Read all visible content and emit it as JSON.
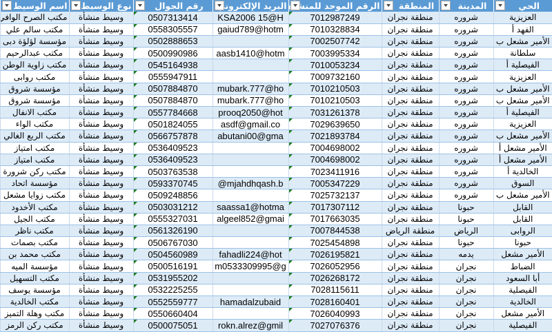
{
  "headers": [
    "الحي",
    "المدينة",
    "المنطقة",
    "الرقم الموحد للمنشأة",
    "البريد الإلكتروني",
    "رقم الجوال",
    "نوع الوسيط",
    "اسم الوسيط"
  ],
  "colors": {
    "header_bg": "#5b9bd5",
    "band": "#ddebf7",
    "error_marker": "#1e7b1e"
  },
  "rows": [
    [
      "العزيزية",
      "شروره",
      "منطقة نجران",
      "7012987249",
      "KSA2006  15@H",
      "0507313414",
      "وسيط منشأة",
      "مكتب الصرح الوافي"
    ],
    [
      "الفهد أ",
      "شروره",
      "منطقة نجران",
      "7010328834",
      "gaiud789@hotm",
      "0558305557",
      "وسيط منشأة",
      "مكتب سالم علي"
    ],
    [
      "الأمير مشعل ب",
      "شروره",
      "منطقة نجران",
      "7002507742",
      "",
      "0502888653",
      "وسيط منشأة",
      "مؤسسة لؤلؤة دبى"
    ],
    [
      "سلطانة",
      "شروره",
      "منطقة نجران",
      "7003995334",
      "aasb1410@hotm",
      "0500990986",
      "وسيط منشأة",
      "مكتب عبدالرحيم"
    ],
    [
      "الفيصلية أ",
      "شروره",
      "منطقة نجران",
      "7010053234",
      "",
      "0545164938",
      "وسيط منشأة",
      "مكتب زاوية الوطن"
    ],
    [
      "العزيزية",
      "شروره",
      "منطقة نجران",
      "7009732160",
      "",
      "0555947911",
      "وسيط منشأة",
      "مكتب روابى"
    ],
    [
      "الأمير مشعل ب",
      "شروره",
      "منطقة نجران",
      "7010210503",
      "mubark.777@ho",
      "0507884870",
      "وسيط منشأة",
      "مؤسسة شروق"
    ],
    [
      "الأمير مشعل ب",
      "شروره",
      "منطقة نجران",
      "7010210503",
      "mubark.777@ho",
      "0507884870",
      "وسيط منشأة",
      "مؤسسة شروق"
    ],
    [
      "الفيصلية أ",
      "شروره",
      "منطقة نجران",
      "7031261378",
      "prooq2050@hot",
      "0557784668",
      "وسيط منشأة",
      "مكتب الانفال"
    ],
    [
      "العزيزية",
      "شروره",
      "منطقة نجران",
      "7029639650",
      "asdf@gmail.co",
      "0501824055",
      "وسيط منشأة",
      "مكتب الواء"
    ],
    [
      "الأمير مشعل ب",
      "شروره",
      "منطقة نجران",
      "7021893784",
      "abutani00@gma",
      "0566757878",
      "وسيط منشأة",
      "مكتب الربع الغالي"
    ],
    [
      "الأمير مشعل أ",
      "شروره",
      "منطقة نجران",
      "7004698002",
      "",
      "0536409523",
      "وسيط منشأة",
      "مكتب امتياز"
    ],
    [
      "الأمير مشعل أ",
      "شروره",
      "منطقة نجران",
      "7004698002",
      "",
      "0536409523",
      "وسيط منشأة",
      "مكتب امتياز"
    ],
    [
      "الخالدية أ",
      "شروره",
      "منطقة نجران",
      "7023411916",
      "",
      "0503763538",
      "وسيط منشأة",
      "مكتب ركن شرورة"
    ],
    [
      "السوق",
      "شروره",
      "منطقة نجران",
      "7005347229",
      "mjahdhqash.b@",
      "0593370745",
      "وسيط منشأة",
      "مؤسسة اتحاد"
    ],
    [
      "الأمير مشعل ب",
      "شروره",
      "منطقة نجران",
      "7025732137",
      "",
      "0509248856",
      "وسيط منشأة",
      "مكتب زوايا مشعل"
    ],
    [
      "القابل",
      "حبونا",
      "منطقة نجران",
      "7017307112",
      "saassa1@hotma",
      "0503031212",
      "وسيط منشأة",
      "مكتب الأخدود"
    ],
    [
      "القابل",
      "حبونا",
      "منطقة نجران",
      "7017663035",
      "algeel852@gmai",
      "0555327031",
      "وسيط منشأة",
      "مكتب الجيل"
    ],
    [
      "الروابى",
      "الرياض",
      "منطقة الرياض",
      "7007844538",
      "",
      "0561326190",
      "وسيط منشأة",
      "مكتب ناظر"
    ],
    [
      "حبونا",
      "حبونا",
      "منطقة نجران",
      "7025454898",
      "",
      "0506767030",
      "وسيط منشأة",
      "مكتب بصمات"
    ],
    [
      "الأمير مشعل",
      "يدمه",
      "منطقة نجران",
      "7026195821",
      "fahadli224@hot",
      "0504560989",
      "وسيط منشأة",
      "مكتب محمد بن"
    ],
    [
      "الضباط",
      "نجران",
      "منطقة نجران",
      "7026052956",
      "m0533309995@g",
      "0500516191",
      "وسيط منشأة",
      "مؤسسة الميه"
    ],
    [
      "أبا السعود",
      "نجران",
      "منطقة نجران",
      "7026268172",
      "",
      "0531955202",
      "وسيط منشأة",
      "مكتب التسهيل"
    ],
    [
      "الفيصلية",
      "نجران",
      "منطقة نجران",
      "7028115611",
      "",
      "0532225255",
      "وسيط منشأة",
      "مؤسسة يوسف"
    ],
    [
      "الخالدية",
      "نجران",
      "منطقة نجران",
      "7028160401",
      "hamadalzubaid",
      "0552559777",
      "وسيط منشأة",
      "مكتب الخالدية"
    ],
    [
      "الأمير مشعل",
      "نجران",
      "منطقة نجران",
      "7026040993",
      "",
      "0550660404",
      "وسيط منشأة",
      "مكتب وهلة التميز"
    ],
    [
      "الفيصلية",
      "نجران",
      "منطقة نجران",
      "7027076376",
      "rokn.alrez@gmil",
      "0500075051",
      "وسيط منشأة",
      "مكتب ركن الرمز"
    ]
  ]
}
